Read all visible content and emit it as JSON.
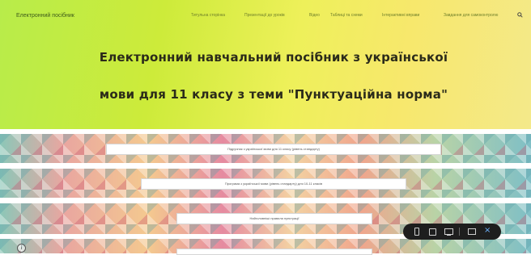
{
  "header": {
    "site_title": "Електронний посібник",
    "nav": [
      "Титульна сторінка",
      "Презентації до уроків",
      "Відео",
      "Таблиці та схеми",
      "Інтерактивні вправи",
      "Завдання для самоконтролю"
    ],
    "search_icon": "search-icon"
  },
  "hero": {
    "title_line1": "Електронний навчальний посібник з української",
    "title_line2": "мови для 11 класу з теми \"Пунктуаційна норма\""
  },
  "documents": [
    "Підручник з української мови для 11 класу (рівень стандарту)",
    "Програма з української мови (рівень стандарту) для 10-11 класів",
    "Найголовніші правила пунктуації",
    ""
  ],
  "toolbar": {
    "icons": [
      "phone-icon",
      "tablet-icon",
      "desktop-icon",
      "comment-icon",
      "close-icon"
    ],
    "close_glyph": "×"
  },
  "info": {
    "glyph": "i"
  },
  "colors": {
    "hero_start": "#b8ec4a",
    "hero_end": "#f4e98a",
    "toolbar_bg": "#1e1e1e",
    "accent_blue": "#6fb4ff"
  }
}
